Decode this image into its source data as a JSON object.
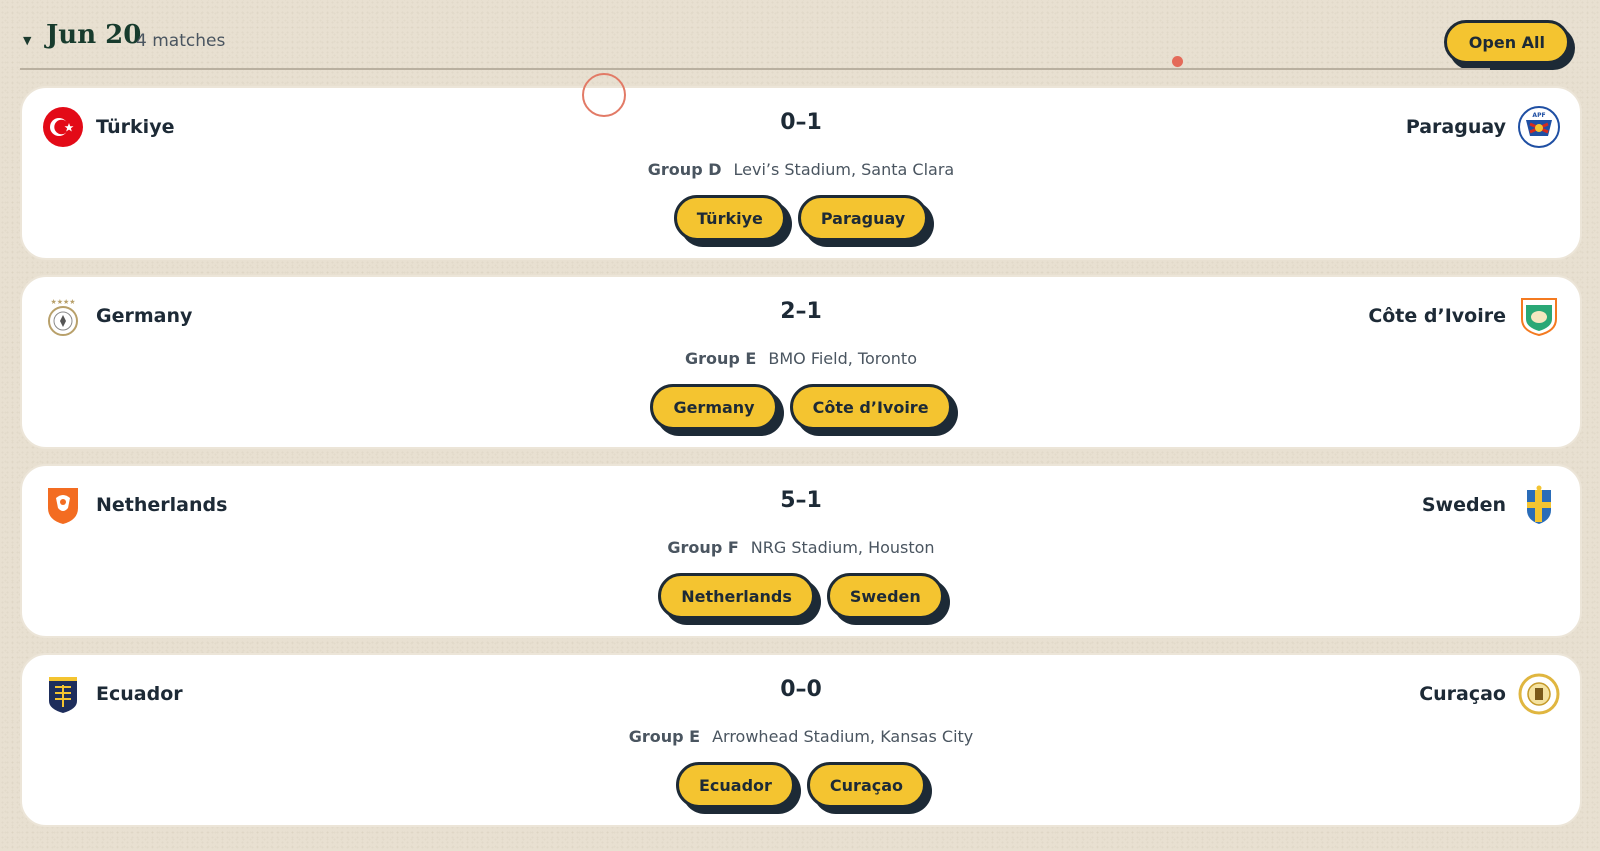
{
  "day": {
    "date": "Jun 20",
    "match_count": "4 matches",
    "open_all_label": "Open All"
  },
  "matches": [
    {
      "home": {
        "name": "Türkiye",
        "crest_icon": "turkiye-crest-icon"
      },
      "away": {
        "name": "Paraguay",
        "crest_icon": "paraguay-crest-icon"
      },
      "score": "0–1",
      "group": "Group D",
      "venue": "Levi’s Stadium, Santa Clara",
      "buttons": [
        "Türkiye",
        "Paraguay"
      ]
    },
    {
      "home": {
        "name": "Germany",
        "crest_icon": "germany-crest-icon"
      },
      "away": {
        "name": "Côte d’Ivoire",
        "crest_icon": "cote-divoire-crest-icon"
      },
      "score": "2–1",
      "group": "Group E",
      "venue": "BMO Field, Toronto",
      "buttons": [
        "Germany",
        "Côte d’Ivoire"
      ]
    },
    {
      "home": {
        "name": "Netherlands",
        "crest_icon": "netherlands-crest-icon"
      },
      "away": {
        "name": "Sweden",
        "crest_icon": "sweden-crest-icon"
      },
      "score": "5–1",
      "group": "Group F",
      "venue": "NRG Stadium, Houston",
      "buttons": [
        "Netherlands",
        "Sweden"
      ]
    },
    {
      "home": {
        "name": "Ecuador",
        "crest_icon": "ecuador-crest-icon"
      },
      "away": {
        "name": "Curaçao",
        "crest_icon": "curacao-crest-icon"
      },
      "score": "0–0",
      "group": "Group E",
      "venue": "Arrowhead Stadium, Kansas City",
      "buttons": [
        "Ecuador",
        "Curaçao"
      ]
    }
  ],
  "colors": {
    "background": "#e8e0d1",
    "card": "#ffffff",
    "accent_button": "#f4c430",
    "ink": "#1d2a36",
    "date_green": "#173b2d",
    "marker_red": "#e46a59"
  }
}
